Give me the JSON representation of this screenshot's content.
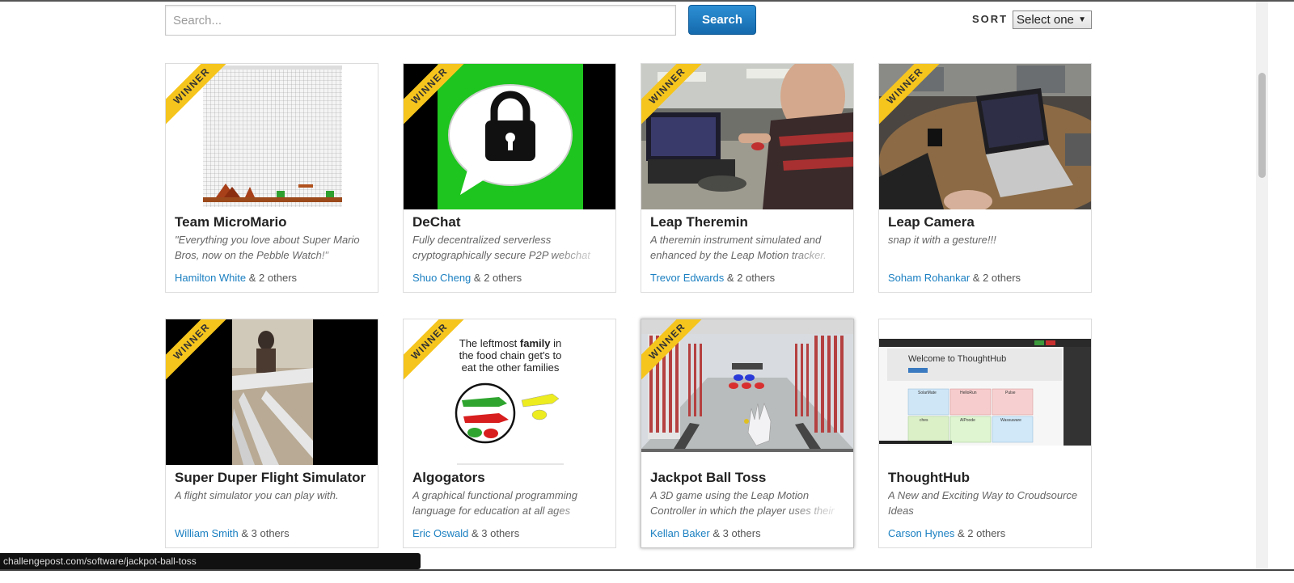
{
  "search": {
    "placeholder": "Search...",
    "button_label": "Search"
  },
  "sort": {
    "label": "SORT",
    "selected": "Select one"
  },
  "ribbon_label": "WINNER",
  "cards": [
    {
      "title": "Team MicroMario",
      "tagline": "\"Everything you love about Super Mario Bros, now on the Pebble Watch!\"",
      "member": "Hamilton White",
      "others": "& 2 others",
      "winner": true
    },
    {
      "title": "DeChat",
      "tagline": "Fully decentralized serverless cryptographically secure P2P webchat",
      "member": "Shuo Cheng",
      "others": "& 2 others",
      "winner": true
    },
    {
      "title": "Leap Theremin",
      "tagline": "A theremin instrument simulated and enhanced by the Leap Motion tracker.",
      "member": "Trevor Edwards",
      "others": "& 2 others",
      "winner": true
    },
    {
      "title": "Leap Camera",
      "tagline": "snap it with a gesture!!!",
      "member": "Soham Rohankar",
      "others": "& 2 others",
      "winner": true
    },
    {
      "title": "Super Duper Flight Simulator",
      "tagline": "A flight simulator you can play with.",
      "member": "William Smith",
      "others": "& 3 others",
      "winner": true
    },
    {
      "title": "Algogators",
      "tagline": "A graphical functional programming language for education at all ages",
      "member": "Eric Oswald",
      "others": "& 3 others",
      "winner": true
    },
    {
      "title": "Jackpot Ball Toss",
      "tagline": "A 3D game using the Leap Motion Controller in which the player uses their",
      "member": "Kellan Baker",
      "others": "& 3 others",
      "winner": true
    },
    {
      "title": "ThoughtHub",
      "tagline": "A New and Exciting Way to Croudsource Ideas",
      "member": "Carson Hynes",
      "others": "& 2 others",
      "winner": false
    }
  ],
  "thumb_text": {
    "algogators_caption": [
      "The leftmost ",
      "family",
      " in",
      "the food chain get's to",
      "eat the other families"
    ],
    "thoughthub_heading": "Welcome to ThoughtHub",
    "thoughthub_cards": [
      "SolarMate",
      "HelloRun",
      "Pulse",
      "ches",
      "AlPoode",
      "Wassuware"
    ]
  },
  "status_url": "challengepost.com/software/jackpot-ball-toss",
  "colors": {
    "accent": "#1b76bd",
    "link": "#1a7fc1",
    "ribbon": "#f6c51d"
  }
}
